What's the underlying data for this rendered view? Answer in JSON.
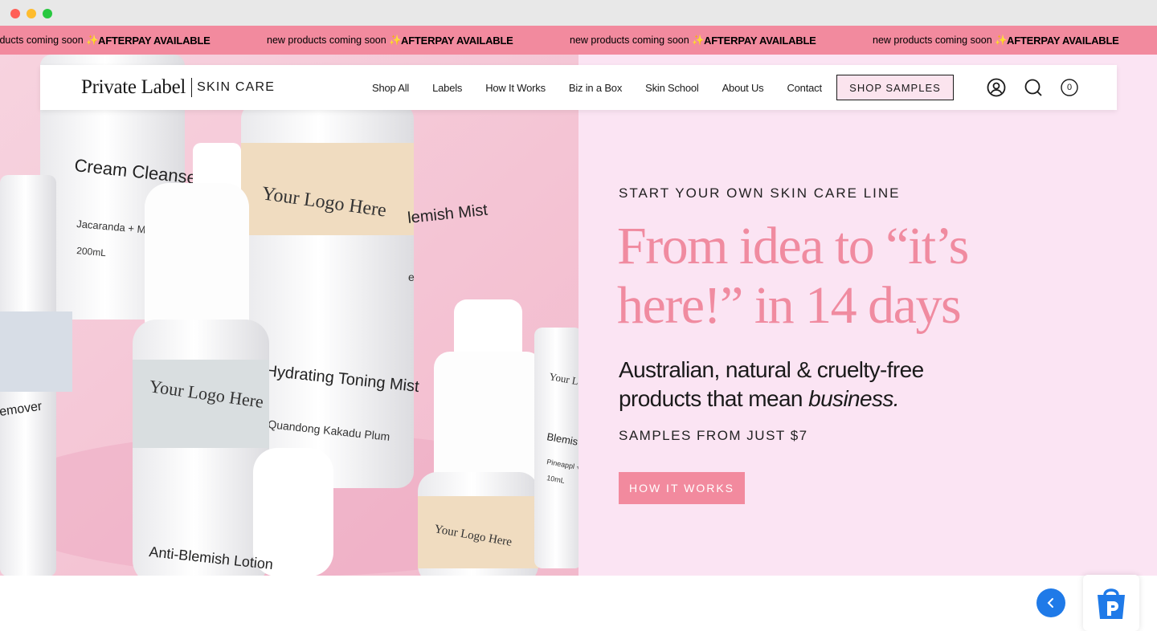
{
  "marquee": {
    "items": [
      "new products coming soon ✨",
      "AFTERPAY AVAILABLE",
      "new products coming soon ✨",
      "AFTERPAY AVAILABLE",
      "new products coming soon ✨",
      "AFTERPAY AVAILABLE",
      "new products coming soon ✨",
      "AFTERPAY AVAILABLE"
    ]
  },
  "header": {
    "logo_main": "Private Label",
    "logo_sub": "SKIN CARE",
    "nav": [
      "Shop All",
      "Labels",
      "How It Works",
      "Biz in a Box",
      "Skin School",
      "About Us",
      "Contact"
    ],
    "shop_samples": "SHOP SAMPLES",
    "cart_count": "0",
    "icons": [
      "account-icon",
      "search-icon",
      "cart-icon"
    ]
  },
  "hero": {
    "eyebrow": "START YOUR OWN SKIN CARE LINE",
    "headline": "From idea to “it’s here!” in 14 days",
    "sub_plain": "Australian, natural & cruelty-free products that mean",
    "sub_italic": "business.",
    "samples": "SAMPLES FROM JUST $7",
    "cta": "HOW IT WORKS",
    "image_labels": [
      "Cream Cleanser",
      "Jacaranda + Mil",
      "200mL",
      "Your Logo Here",
      "lemish Mist",
      "e",
      "Hydrating Toning Mist",
      "Quandong Kakadu Plum",
      "Your Logo Here",
      "emover",
      "Your Logo Here",
      "Blemis Spot F",
      "Pineappl + Licorice",
      "10mL",
      "Anti-Blemish Lotion",
      "Your Logo Here"
    ]
  },
  "colors": {
    "accent": "#f28a9e",
    "headline": "#f08ba0",
    "hero_bg": "#fbe4f3",
    "back_button": "#1f7ae8"
  }
}
